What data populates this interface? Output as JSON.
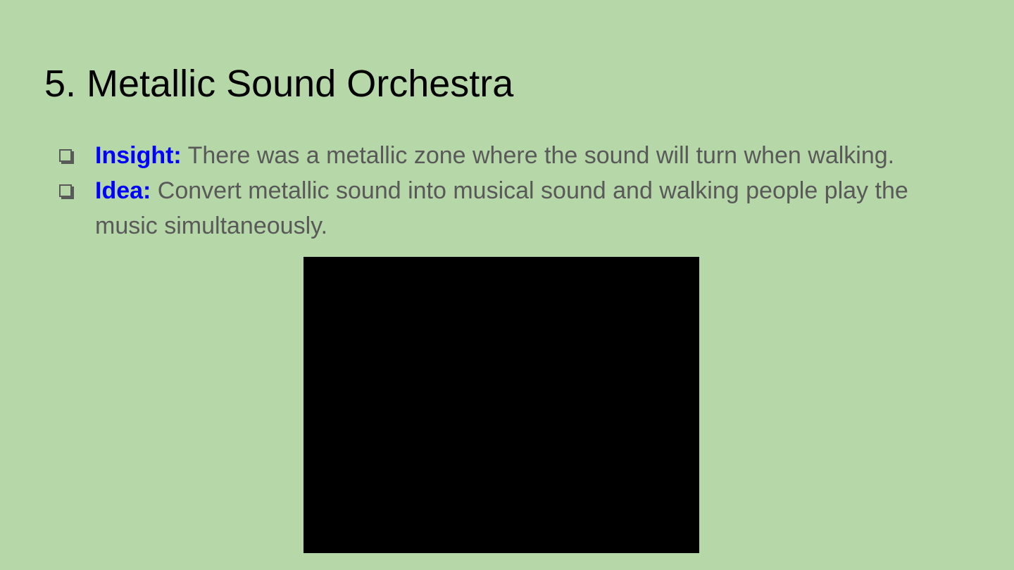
{
  "colors": {
    "background": "#b6d7a8",
    "title": "#000000",
    "body_text": "#595959",
    "label": "#0000ff",
    "media_block": "#000000"
  },
  "slide": {
    "title": "5. Metallic Sound Orchestra",
    "bullets": [
      {
        "icon": "checkbox-icon",
        "label": "Insight:",
        "text": " There was a metallic zone where the sound will turn when walking."
      },
      {
        "icon": "checkbox-icon",
        "label": "Idea:",
        "text": " Convert metallic sound into musical sound and walking people play the music simultaneously."
      }
    ]
  }
}
